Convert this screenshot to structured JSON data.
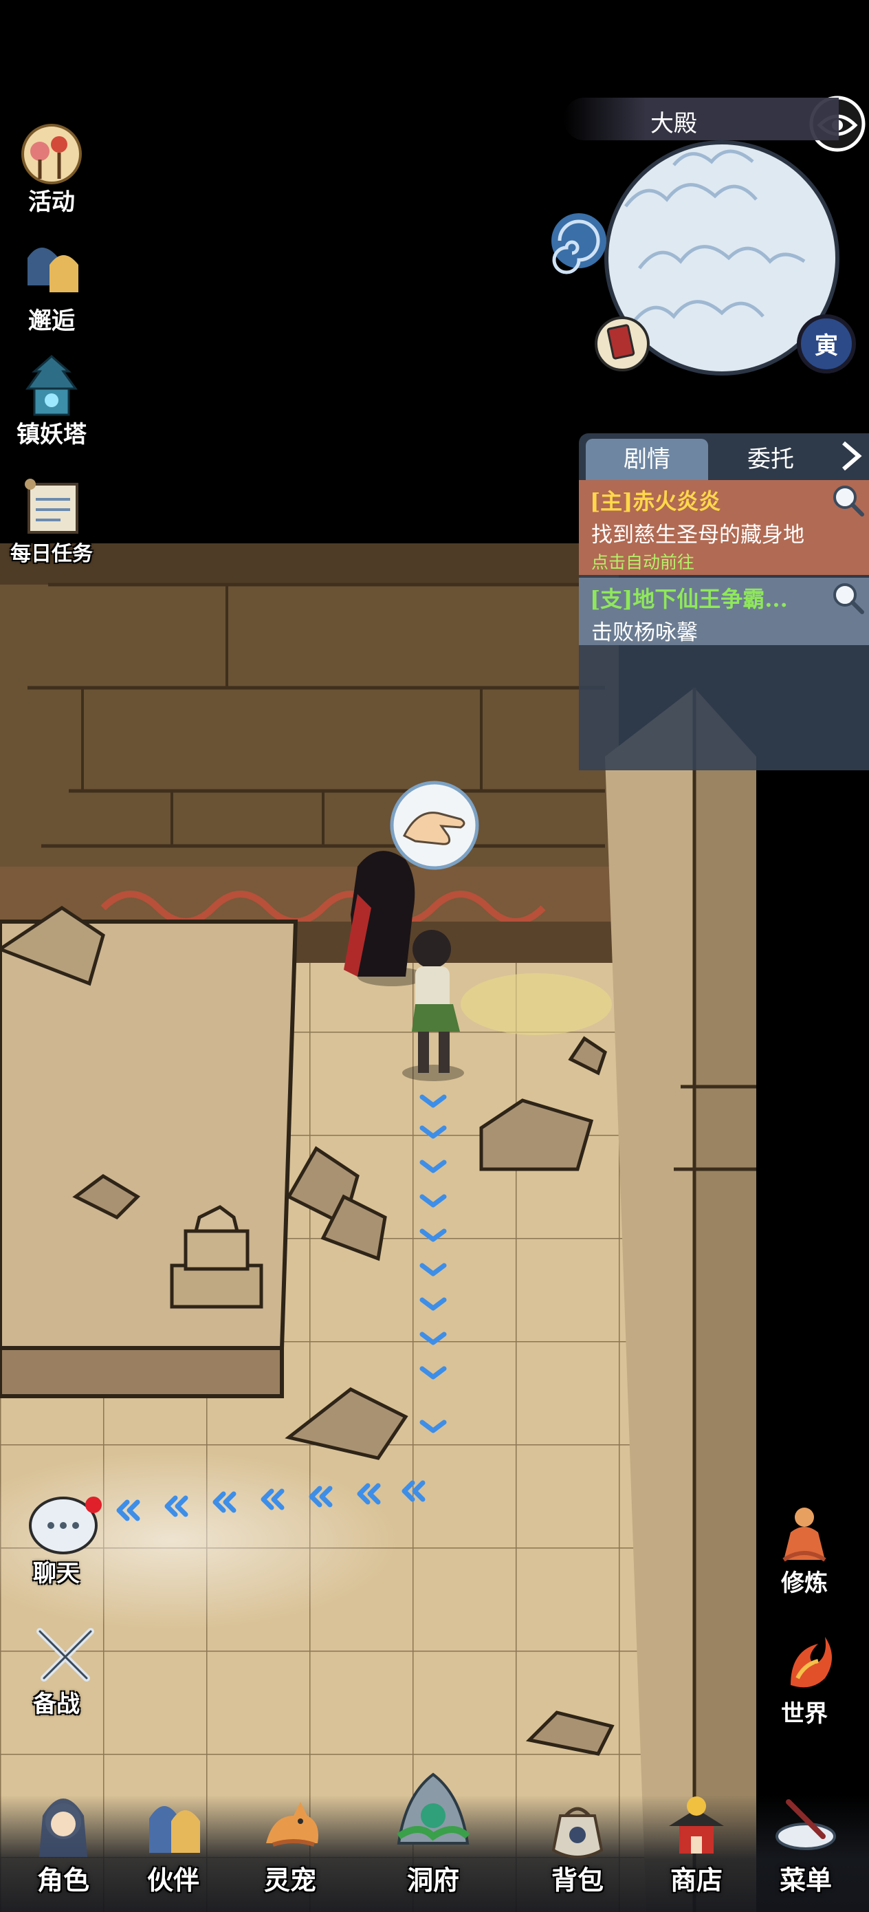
{
  "minimap": {
    "title": "大殿",
    "time_badge": "寅"
  },
  "side_menu": {
    "events": "活动",
    "encounter": "邂逅",
    "demon_tower": "镇妖塔",
    "daily_tasks": "每日任务"
  },
  "quest_panel": {
    "tabs": {
      "story": "剧情",
      "commission": "委托"
    },
    "main_quest": {
      "title": "[主]赤火炎炎",
      "description": "找到慈生圣母的藏身地",
      "hint": "点击自动前往"
    },
    "side_quest": {
      "title": "[支]地下仙王争霸...",
      "description": "击败杨咏馨"
    }
  },
  "left_actions": {
    "chat": "聊天",
    "prepare": "备战"
  },
  "right_actions": {
    "cultivate": "修炼",
    "world": "世界"
  },
  "bottom_nav": {
    "character": "角色",
    "partner": "伙伴",
    "spirit_pet": "灵宠",
    "cave": "洞府",
    "backpack": "背包",
    "shop": "商店",
    "menu": "菜单"
  },
  "colors": {
    "main_quest_bg": "#b16a53",
    "main_quest_title": "#ffd84a",
    "side_quest_title": "#8fe85a",
    "path_arrow": "#3d8ee8",
    "chat_notification": "#e0202a"
  }
}
